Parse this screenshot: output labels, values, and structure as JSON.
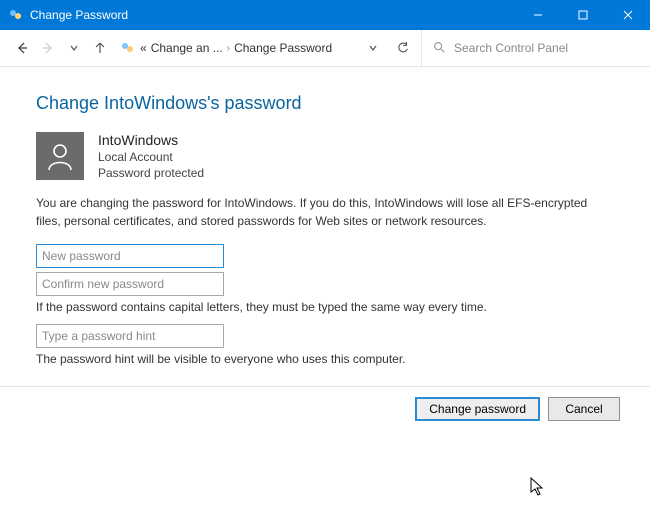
{
  "window": {
    "title": "Change Password"
  },
  "breadcrumb": {
    "item1": "Change an ...",
    "item2": "Change Password"
  },
  "search": {
    "placeholder": "Search Control Panel"
  },
  "page": {
    "heading": "Change IntoWindows's password",
    "user": {
      "name": "IntoWindows",
      "account_type": "Local Account",
      "protection": "Password protected"
    },
    "warning": "You are changing the password for IntoWindows.  If you do this, IntoWindows will lose all EFS-encrypted files, personal certificates, and stored passwords for Web sites or network resources.",
    "fields": {
      "new_password_placeholder": "New password",
      "confirm_password_placeholder": "Confirm new password",
      "hint_placeholder": "Type a password hint"
    },
    "note_caps": "If the password contains capital letters, they must be typed the same way every time.",
    "note_hint": "The password hint will be visible to everyone who uses this computer.",
    "buttons": {
      "change": "Change password",
      "cancel": "Cancel"
    }
  }
}
